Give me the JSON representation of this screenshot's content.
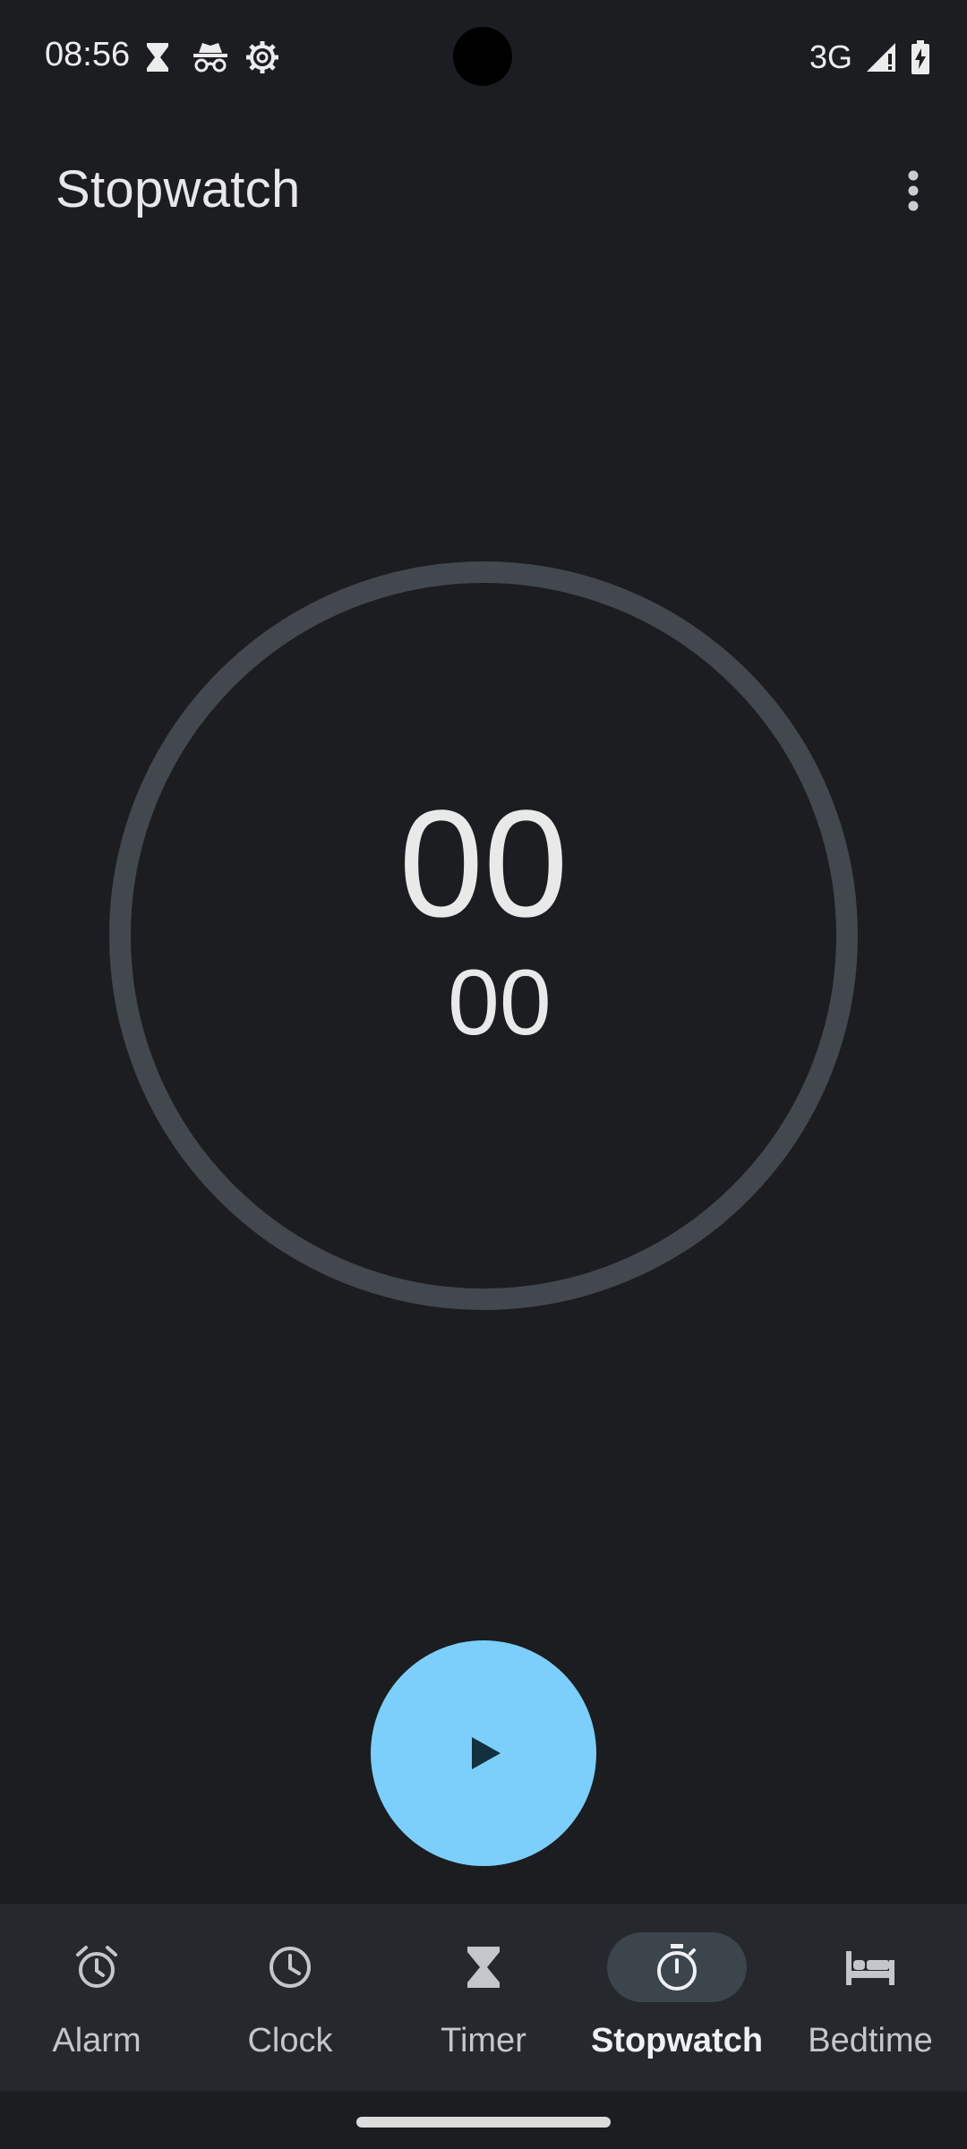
{
  "status_bar": {
    "time": "08:56",
    "icons": [
      "hourglass-icon",
      "incognito-icon",
      "settings-gear-icon"
    ],
    "network": "3G",
    "right_icons": [
      "signal-icon",
      "battery-charging-icon"
    ]
  },
  "app_bar": {
    "title": "Stopwatch",
    "overflow_icon": "more-vert-icon"
  },
  "stopwatch": {
    "main_time": "00",
    "hundredths": "00"
  },
  "fab": {
    "icon": "play-icon"
  },
  "bottom_nav": {
    "items": [
      {
        "label": "Alarm",
        "icon": "alarm-icon",
        "active": false
      },
      {
        "label": "Clock",
        "icon": "clock-icon",
        "active": false
      },
      {
        "label": "Timer",
        "icon": "hourglass-icon",
        "active": false
      },
      {
        "label": "Stopwatch",
        "icon": "stopwatch-icon",
        "active": true
      },
      {
        "label": "Bedtime",
        "icon": "bed-icon",
        "active": false
      }
    ]
  },
  "colors": {
    "background": "#1b1d20",
    "accent": "#7ccffa",
    "dial_ring": "#42484d",
    "nav_background": "#25282c",
    "active_pill": "#3c444c"
  }
}
